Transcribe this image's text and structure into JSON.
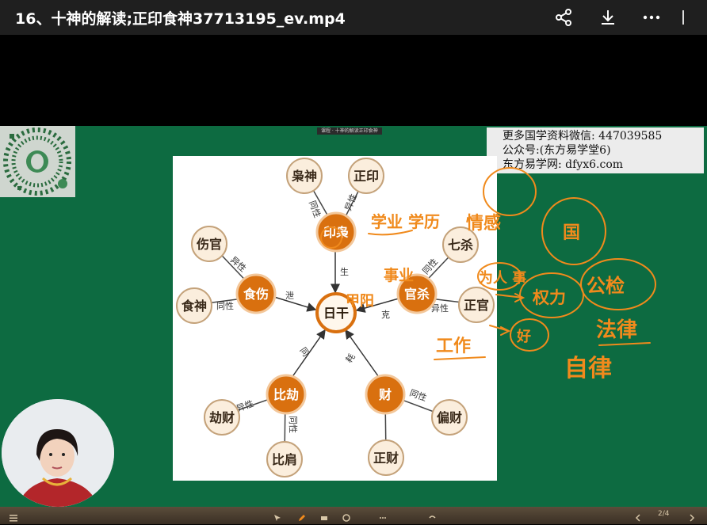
{
  "header": {
    "title": "16、十神的解读;正印食神37713195_ev.mp4",
    "share_icon": "share-icon",
    "download_icon": "download-icon",
    "more_icon": "more-icon"
  },
  "board": {
    "mini_label": "课程 · 十神的解读正印食神",
    "info_lines": [
      "更多国学资料微信: 447039585",
      "公众号:(东方易学堂6)",
      "东方易学网: dfyx6.com"
    ],
    "qr_icon": "qr-code-icon"
  },
  "diagram": {
    "center": "日干",
    "hubs": {
      "yinxiao": "印枭",
      "shishang": "食伤",
      "guansha": "官杀",
      "bijie": "比劫",
      "cai": "财"
    },
    "leaves": {
      "xiaoshen": "枭神",
      "zhengyin": "正印",
      "shangguan": "伤官",
      "shishen": "食神",
      "qisha": "七杀",
      "zhengguan": "正官",
      "jiecai": "劫财",
      "bijian": "比肩",
      "piancai": "偏财",
      "zhengcai": "正财"
    },
    "edges": {
      "tongxing": "同性",
      "yixing": "异性",
      "sheng": "生",
      "xie": "泄",
      "ke": "克",
      "tong": "同",
      "hao": "耗"
    }
  },
  "annotations": {
    "xueye": "学业 学历",
    "shiye": "事业",
    "jiayang": "甲阳",
    "ganqing": "情感",
    "guo": "国",
    "weiren": "为人 事",
    "quanli": "权力",
    "gongjian": "公检",
    "falv": "法律",
    "zilv": "自律",
    "gongzuo": "工作",
    "hao": "好"
  },
  "footer": {
    "page_label": "2/4"
  },
  "colors": {
    "board": "#0d6b41",
    "node_orange": "#d9700f",
    "node_leaf_bg": "#fbeedd",
    "ink": "#f08a1c"
  }
}
